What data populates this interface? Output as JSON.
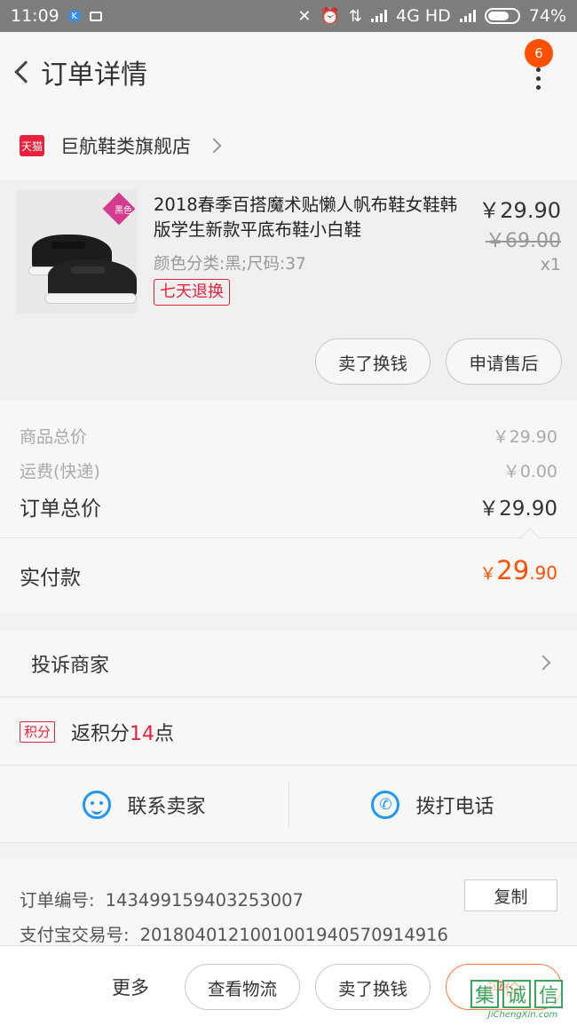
{
  "status_bar": {
    "time": "11:09",
    "k_icon": "K",
    "network": "4G HD",
    "battery": "74%",
    "battery_level": 0.74
  },
  "header": {
    "back_icon": "chevron-left-icon",
    "title": "订单详情",
    "more_icon": "vertical-dots-icon",
    "badge_count": "6"
  },
  "store": {
    "platform_badge": "天猫",
    "name": "巨航鞋类旗舰店"
  },
  "product": {
    "name": "2018春季百搭魔术贴懒人帆布鞋女鞋韩版学生新款平底布鞋小白鞋",
    "attributes": "颜色分类:黑;尺码:37",
    "return_tag": "七天退换",
    "price": "￥29.90",
    "original_price": "￥69.00",
    "quantity": "x1",
    "image_tag": "黑色",
    "buttons": {
      "sell_label": "卖了换钱",
      "aftersale_label": "申请售后"
    }
  },
  "summary": {
    "goods_total_label": "商品总价",
    "goods_total_value": "￥29.90",
    "shipping_label": "运费(快递)",
    "shipping_value": "￥0.00",
    "order_total_label": "订单总价",
    "order_total_value": "￥29.90",
    "paid_label": "实付款",
    "paid_currency": "￥",
    "paid_integer": "29",
    "paid_decimal": ".90"
  },
  "complaint": {
    "label": "投诉商家"
  },
  "points": {
    "badge": "积分",
    "prefix": "返积分",
    "amount": "14",
    "suffix": "点"
  },
  "contact": {
    "seller_label": "联系卖家",
    "phone_label": "拨打电话"
  },
  "order_info": {
    "order_no_label": "订单编号:",
    "order_no": "143499159403253007",
    "copy_label": "复制",
    "alipay_label": "支付宝交易号:",
    "alipay_no": "20180401210010019405709​14916"
  },
  "bottom_bar": {
    "more_label": "更多",
    "logistics_label": "查看物流",
    "sell_label": "卖了换钱",
    "review_label": "评价"
  },
  "watermark": {
    "glyphs": [
      "集",
      "诚",
      "信"
    ],
    "text": "JiChengXin.com"
  },
  "colors": {
    "accent": "#ff5000",
    "tmall_red": "#e8213c",
    "link_blue": "#2196f3"
  }
}
